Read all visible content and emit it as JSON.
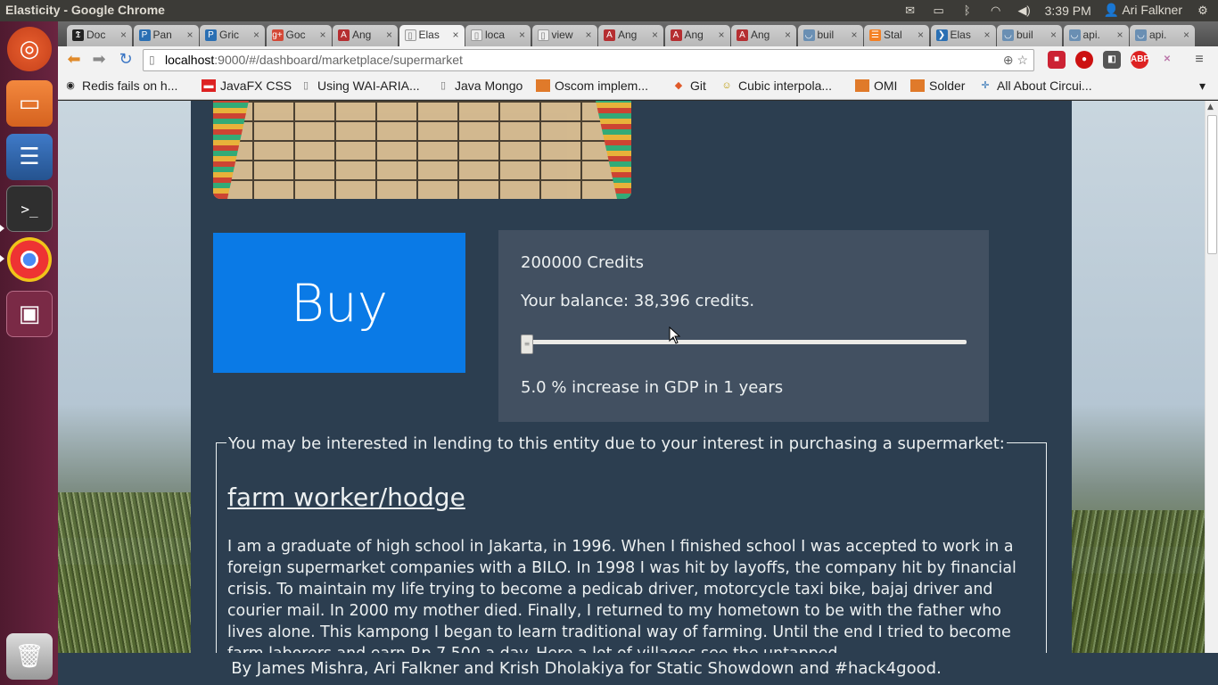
{
  "system": {
    "window_title": "Elasticity - Google Chrome",
    "time": "3:39 PM",
    "user": "Ari Falkner"
  },
  "tabs": [
    {
      "label": "Doc",
      "icon": "nyt-icon"
    },
    {
      "label": "Pan",
      "icon": "p-icon"
    },
    {
      "label": "Gric",
      "icon": "p-icon"
    },
    {
      "label": "Goc",
      "icon": "gplus-icon"
    },
    {
      "label": "Ang",
      "icon": "angular-icon"
    },
    {
      "label": "Elas",
      "icon": "page-icon",
      "active": true
    },
    {
      "label": "loca",
      "icon": "page-icon"
    },
    {
      "label": "view",
      "icon": "page-icon"
    },
    {
      "label": "Ang",
      "icon": "angular-icon"
    },
    {
      "label": "Ang",
      "icon": "angular-icon"
    },
    {
      "label": "Ang",
      "icon": "angular-icon"
    },
    {
      "label": "buil",
      "icon": "cup-icon"
    },
    {
      "label": "Stal",
      "icon": "so-icon"
    },
    {
      "label": "Elas",
      "icon": "code-icon"
    },
    {
      "label": "buil",
      "icon": "cup-icon"
    },
    {
      "label": "api.",
      "icon": "cup-icon"
    },
    {
      "label": "api.",
      "icon": "cup-icon"
    }
  ],
  "address": {
    "host": "localhost",
    "rest": ":9000/#/dashboard/marketplace/supermarket"
  },
  "bookmarks": [
    {
      "label": "Redis fails on h..."
    },
    {
      "label": "JavaFX CSS"
    },
    {
      "label": "Using WAI-ARIA..."
    },
    {
      "label": "Java Mongo"
    },
    {
      "label": "Oscom implem..."
    },
    {
      "label": "Git"
    },
    {
      "label": "Cubic interpola..."
    },
    {
      "label": "OMI"
    },
    {
      "label": "Solder"
    },
    {
      "label": "All About Circui..."
    }
  ],
  "page": {
    "buy_label": "Buy",
    "credits": "200000 Credits",
    "balance": "Your balance: 38,396 credits.",
    "slider_fraction": 0.0,
    "gdp_text": "5.0 % increase in GDP in 1 years",
    "legend": "You may be interested in lending to this entity due to your interest in purchasing a supermarket:",
    "entity_title": "farm worker/hodge",
    "entity_description": "I am a graduate of high school in Jakarta, in 1996. When I finished school I was accepted to work in a foreign supermarket companies with a BILO. In 1998 I was hit by layoffs, the company hit by financial crisis. To maintain my life trying to become a pedicab driver, motorcycle taxi bike, bajaj driver and courier mail. In 2000 my mother died. Finally, I returned to my hometown to be with the father who lives alone. This kampong I began to learn traditional way of farming. Until the end I tried to become farm laborers and earn Rp 7,500 a day. Here a lot of villages see the untapped"
  },
  "footer": "By James Mishra, Ari Falkner and Krish Dholakiya for Static Showdown and #hack4good.",
  "colors": {
    "page_bg": "#2c3e50",
    "panel_bg": "#425061",
    "buy_button": "#0a7ae6"
  }
}
